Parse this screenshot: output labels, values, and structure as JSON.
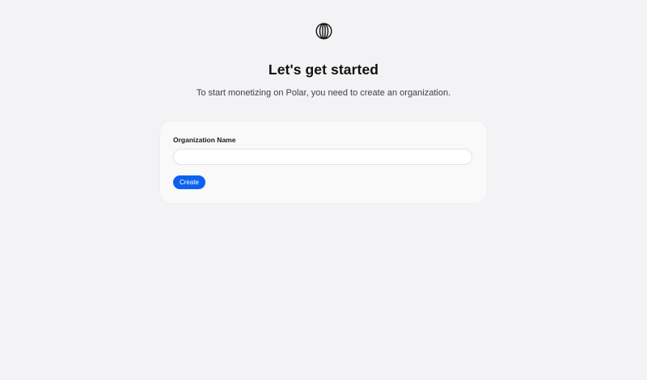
{
  "brand": {
    "logo_icon": "polar-logo-icon",
    "accent_color": "#0c62ef"
  },
  "header": {
    "title": "Let's get started",
    "subtitle": "To start monetizing on Polar, you need to create an organization."
  },
  "form": {
    "name_label": "Organization Name",
    "name_value": "",
    "name_placeholder": "",
    "submit_label": "Create"
  }
}
